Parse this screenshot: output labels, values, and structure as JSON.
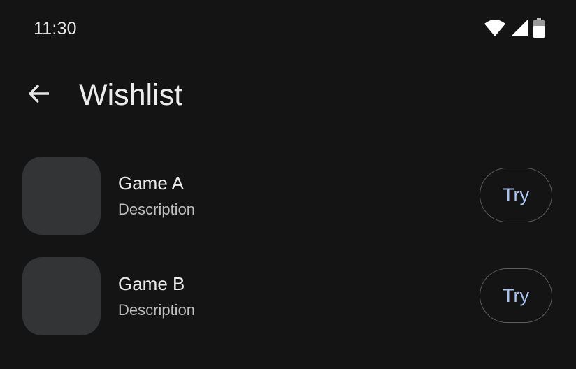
{
  "status_bar": {
    "time": "11:30",
    "icons": [
      "wifi-icon",
      "cellular-signal-icon",
      "battery-icon"
    ]
  },
  "header": {
    "back_icon": "arrow-back-icon",
    "title": "Wishlist"
  },
  "wishlist": {
    "items": [
      {
        "title": "Game A",
        "description": "Description",
        "action_label": "Try"
      },
      {
        "title": "Game B",
        "description": "Description",
        "action_label": "Try"
      }
    ]
  },
  "colors": {
    "background": "#141414",
    "thumbnail": "#333436",
    "accent": "#a8c4f2",
    "button_border": "#5e5e5e"
  }
}
